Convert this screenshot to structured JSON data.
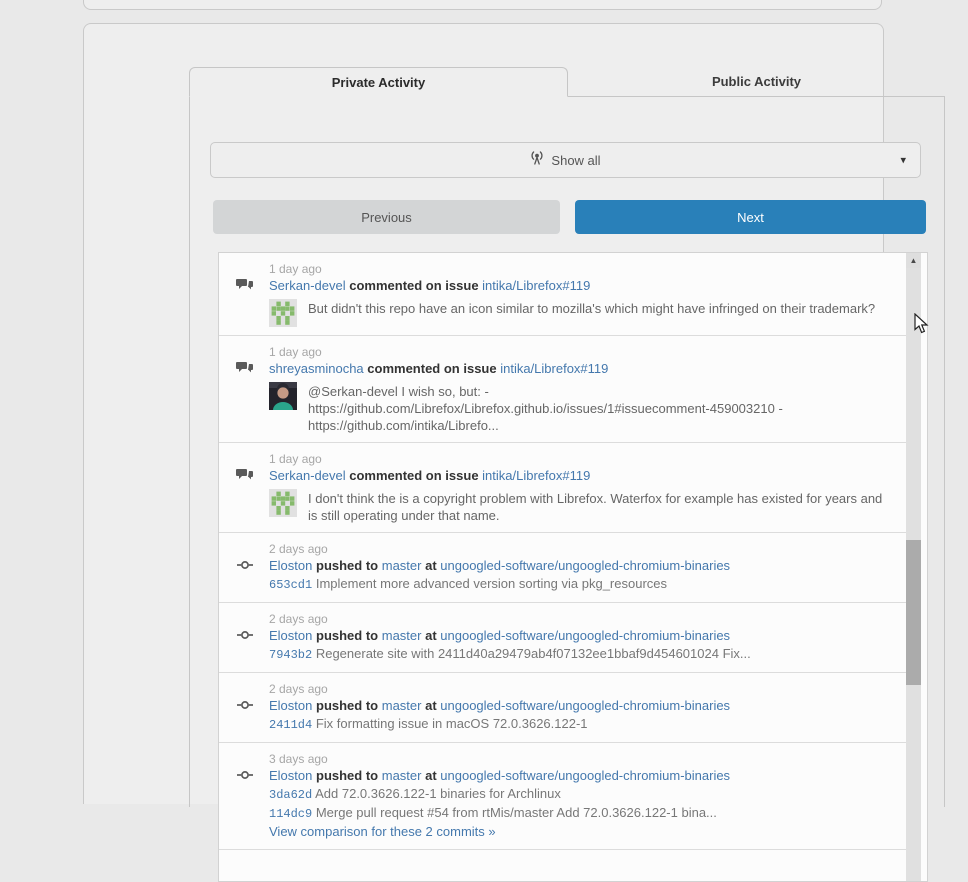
{
  "tabs": [
    {
      "label": "Private Activity",
      "active": true
    },
    {
      "label": "Public Activity",
      "active": false
    }
  ],
  "filter": {
    "label": "Show all",
    "icon": "broadcast-icon"
  },
  "pagination": {
    "previous_label": "Previous",
    "next_label": "Next"
  },
  "colors": {
    "accent_blue": "#2980b9",
    "link_blue": "#4478ad"
  },
  "feed": [
    {
      "type": "comment",
      "time": "1 day ago",
      "actor": "Serkan-devel",
      "action": "commented on issue",
      "target": "intika/Librefox#119",
      "avatar": "identicon-green",
      "body": "But didn't this repo have an icon similar to mozilla's which might have infringed on their trademark?"
    },
    {
      "type": "comment",
      "time": "1 day ago",
      "actor": "shreyasminocha",
      "action": "commented on issue",
      "target": "intika/Librefox#119",
      "avatar": "photo",
      "body": "@Serkan-devel I wish so, but: - https://github.com/Librefox/Librefox.github.io/issues/1#issuecomment-459003210 - https://github.com/intika/Librefo..."
    },
    {
      "type": "comment",
      "time": "1 day ago",
      "actor": "Serkan-devel",
      "action": "commented on issue",
      "target": "intika/Librefox#119",
      "avatar": "identicon-green",
      "body": "I don't think the is a copyright problem with Librefox. Waterfox for example has existed for years and is still operating under that name."
    },
    {
      "type": "push",
      "time": "2 days ago",
      "actor": "Eloston",
      "action": "pushed to",
      "branch": "master",
      "at_word": "at",
      "repo": "ungoogled-software/ungoogled-chromium-binaries",
      "commits": [
        {
          "sha": "653cd1",
          "message": "Implement more advanced version sorting via pkg_resources"
        }
      ]
    },
    {
      "type": "push",
      "time": "2 days ago",
      "actor": "Eloston",
      "action": "pushed to",
      "branch": "master",
      "at_word": "at",
      "repo": "ungoogled-software/ungoogled-chromium-binaries",
      "commits": [
        {
          "sha": "7943b2",
          "message": "Regenerate site with 2411d40a29479ab4f07132ee1bbaf9d454601024 Fix..."
        }
      ]
    },
    {
      "type": "push",
      "time": "2 days ago",
      "actor": "Eloston",
      "action": "pushed to",
      "branch": "master",
      "at_word": "at",
      "repo": "ungoogled-software/ungoogled-chromium-binaries",
      "commits": [
        {
          "sha": "2411d4",
          "message": "Fix formatting issue in macOS 72.0.3626.122-1"
        }
      ]
    },
    {
      "type": "push",
      "time": "3 days ago",
      "actor": "Eloston",
      "action": "pushed to",
      "branch": "master",
      "at_word": "at",
      "repo": "ungoogled-software/ungoogled-chromium-binaries",
      "commits": [
        {
          "sha": "3da62d",
          "message": "Add 72.0.3626.122-1 binaries for Archlinux"
        },
        {
          "sha": "114dc9",
          "message": "Merge pull request #54 from rtMis/master Add 72.0.3626.122-1 bina..."
        }
      ],
      "compare_link": "View comparison for these 2 commits »"
    }
  ]
}
